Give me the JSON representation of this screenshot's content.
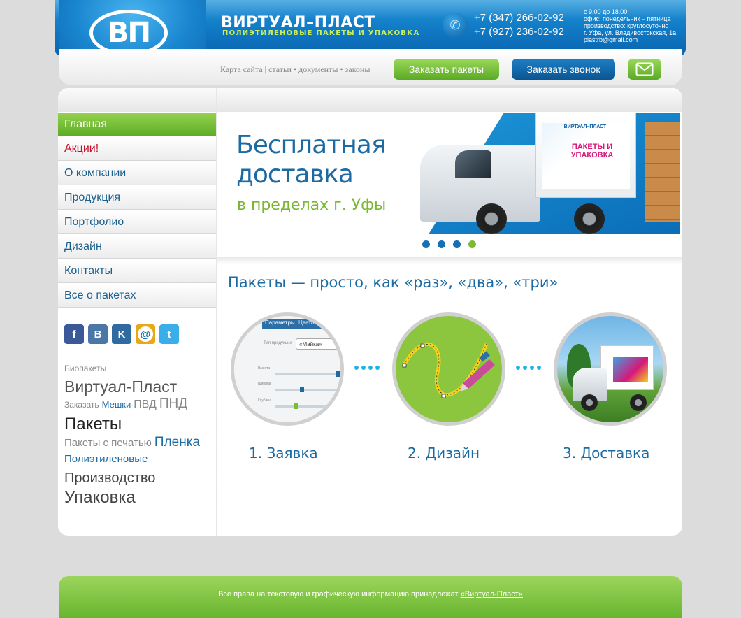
{
  "header": {
    "logo_text": "ВП",
    "brand_name": "ВИРТУАЛ–ПЛАСТ",
    "brand_sub": "ПОЛИЭТИЛЕНОВЫЕ ПАКЕТЫ И УПАКОВКА",
    "phone_1": "+7 (347) 266-02-92",
    "phone_2": "+7 (927) 236-02-92",
    "hours": [
      "с 9.00 до 18.00",
      "офис: понедельник – пятница",
      "производство: круглосуточно",
      "г. Уфа, ул. Владивостокская, 1а",
      "plastrb@gmail.com"
    ]
  },
  "toplinks": {
    "sitemap": "Карта сайта",
    "articles": "статьи",
    "documents": "документы",
    "laws": "законы"
  },
  "buttons": {
    "order_packets": "Заказать пакеты",
    "order_call": "Заказать звонок",
    "mail_icon": "envelope-icon"
  },
  "nav": [
    {
      "label": "Главная"
    },
    {
      "label": "Акции!"
    },
    {
      "label": "О компании"
    },
    {
      "label": "Продукция"
    },
    {
      "label": "Портфолио"
    },
    {
      "label": "Дизайн"
    },
    {
      "label": "Контакты"
    },
    {
      "label": "Все о пакетах"
    }
  ],
  "social": {
    "facebook": "f",
    "vkontakte_b": "B",
    "vkontakte_k": "K",
    "mailru": "@",
    "twitter": "t"
  },
  "tags": {
    "bio": "Биопакеты",
    "virtual": "Виртуал-Пласт",
    "order": "Заказать",
    "bags": "Мешки",
    "pvd": "ПВД",
    "pnd": "ПНД",
    "packets": "Пакеты",
    "printed": "Пакеты с печатью",
    "film": "Пленка",
    "poly": "Полиэтиленовые",
    "production": "Производство",
    "packaging": "Упаковка"
  },
  "banner": {
    "title_line1": "Бесплатная",
    "title_line2": "доставка",
    "subtitle": "в пределах г. Уфы",
    "truck_brand": "ВИРТУАЛ–ПЛАСТ",
    "truck_text": "ПАКЕТЫ И УПАКОВКА",
    "active_slide": 4,
    "slides": 4
  },
  "steps": {
    "title": "Пакеты — просто, как «раз», «два», «три»",
    "items": [
      {
        "label": "1. Заявка",
        "tab1": "Параметры",
        "tab2": "Цвета",
        "field": "«Майка»",
        "field_label": "Тип продукции",
        "row1": "Высота",
        "row2": "Ширина",
        "row3": "Глубина"
      },
      {
        "label": "2. Дизайн"
      },
      {
        "label": "3. Доставка"
      }
    ]
  },
  "footer": {
    "text": "Все права на текстовую и графическую информацию принадлежат",
    "link": "«Виртуал-Пласт»"
  }
}
